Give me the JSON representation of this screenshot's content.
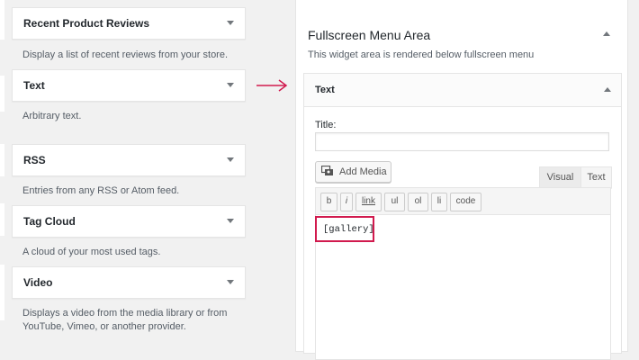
{
  "available_widgets": [
    {
      "title": "Recent Product Reviews",
      "description": "Display a list of recent reviews from your store."
    },
    {
      "title": "Text",
      "description": "Arbitrary text."
    },
    {
      "title": "RSS",
      "description": "Entries from any RSS or Atom feed."
    },
    {
      "title": "Tag Cloud",
      "description": "A cloud of your most used tags."
    },
    {
      "title": "Video",
      "description_line1": "Displays a video from the media library or from",
      "description_line2": "YouTube, Vimeo, or another provider."
    }
  ],
  "sidebar": {
    "title": "Fullscreen Menu Area",
    "description": "This widget area is rendered below fullscreen menu"
  },
  "text_widget": {
    "title": "Text",
    "title_label": "Title:",
    "title_value": "",
    "add_media_label": "Add Media",
    "tabs": {
      "visual": "Visual",
      "text": "Text"
    },
    "quicktags": [
      "b",
      "i",
      "link",
      "ul",
      "ol",
      "li",
      "code"
    ],
    "content": "[gallery]"
  },
  "colors": {
    "accent": "#d11a4e"
  },
  "icons": {
    "arrow": "right-arrow-icon",
    "media": "add-media-icon",
    "toggle": "caret-icon"
  }
}
